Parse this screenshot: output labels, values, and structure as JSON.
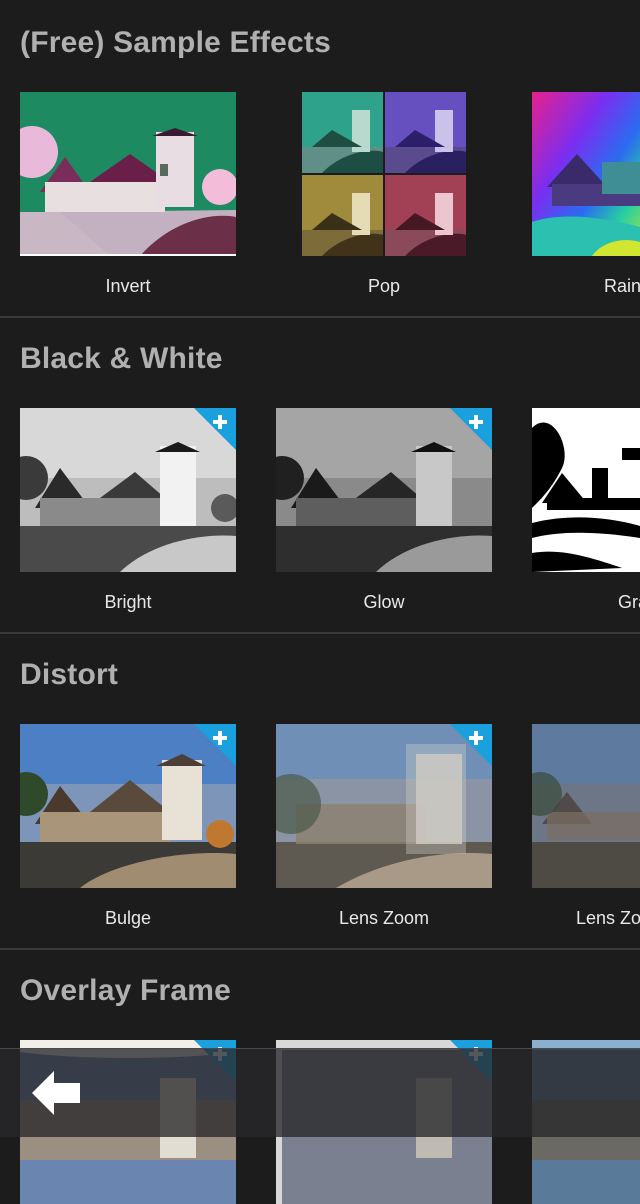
{
  "sections": [
    {
      "title": "(Free) Sample Effects",
      "items": [
        {
          "label": "Invert"
        },
        {
          "label": "Pop"
        },
        {
          "label": "Rain"
        }
      ]
    },
    {
      "title": "Black & White",
      "items": [
        {
          "label": "Bright"
        },
        {
          "label": "Glow"
        },
        {
          "label": "Gra"
        }
      ]
    },
    {
      "title": "Distort",
      "items": [
        {
          "label": "Bulge"
        },
        {
          "label": "Lens Zoom"
        },
        {
          "label": "Lens Zo"
        }
      ]
    },
    {
      "title": "Overlay Frame",
      "items": []
    }
  ],
  "icons": {
    "premium_badge": "plus-corner-icon",
    "back": "back-arrow-icon"
  },
  "colors": {
    "background": "#1c1c1d",
    "section_title": "#b0b0b0",
    "caption": "#e8e8e8",
    "badge": "#1aa0dc"
  }
}
